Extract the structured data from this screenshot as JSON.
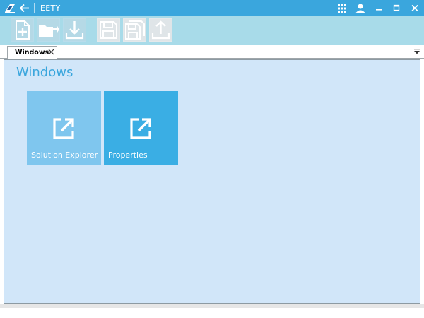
{
  "window": {
    "title": "EETY",
    "icons": {
      "logo": "app-logo-icon",
      "back": "back-arrow-icon",
      "apps": "apps-grid-icon",
      "user": "user-icon",
      "minimize": "minimize-icon",
      "maximize": "maximize-icon",
      "close": "close-icon"
    }
  },
  "toolbar": {
    "tools": [
      {
        "icon": "new-document-icon",
        "enabled": true
      },
      {
        "icon": "open-folder-icon",
        "enabled": true
      },
      {
        "icon": "download-icon",
        "enabled": true
      },
      {
        "icon": "save-icon",
        "enabled": false
      },
      {
        "icon": "save-all-icon",
        "enabled": false
      },
      {
        "icon": "upload-icon",
        "enabled": false
      }
    ]
  },
  "tabs": [
    {
      "label": "Windows",
      "active": true
    }
  ],
  "main": {
    "title": "Windows",
    "tiles": [
      {
        "label": "Solution Explorer",
        "icon": "open-external-icon",
        "color": "#7fc6ee"
      },
      {
        "label": "Properties",
        "icon": "open-external-icon",
        "color": "#3aaee4"
      }
    ]
  },
  "colors": {
    "accent": "#3aa6dd",
    "toolbar": "#a8dbe9",
    "content_background": "#d1e6f9"
  }
}
